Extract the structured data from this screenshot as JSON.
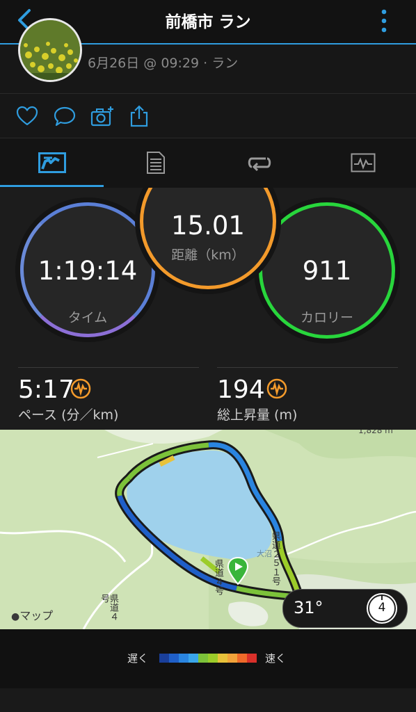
{
  "header": {
    "title": "前橋市 ラン",
    "date_line": "6月26日 @ 09:29 · ラン"
  },
  "icons": {
    "back": "chevron-left-icon",
    "menu": "vertical-ellipsis-icon",
    "like": "heart-icon",
    "comment": "speech-bubble-icon",
    "photo": "camera-add-icon",
    "share": "share-icon"
  },
  "tabs": [
    {
      "name": "overview",
      "icon": "running-chart-icon",
      "active": true
    },
    {
      "name": "details",
      "icon": "document-icon",
      "active": false
    },
    {
      "name": "laps",
      "icon": "laps-loop-icon",
      "active": false
    },
    {
      "name": "charts",
      "icon": "graph-icon",
      "active": false
    }
  ],
  "stats": {
    "time": {
      "value": "1:19:14",
      "label": "タイム"
    },
    "distance": {
      "value": "15.01",
      "label": "距離（km）"
    },
    "calories": {
      "value": "911",
      "label": "カロリー"
    },
    "pace": {
      "value": "5:17",
      "label": "ペース (分／km)"
    },
    "elevation": {
      "value": "194",
      "label": "総上昇量 (m)"
    }
  },
  "map": {
    "attribution": "マップ",
    "scale": "1,828 m",
    "lake_label": "大沼",
    "road_labels": [
      "県道４号",
      "県道２５１号",
      "県道４号"
    ],
    "temperature": "31°",
    "compass_value": "4"
  },
  "legend": {
    "slow": "遅く",
    "fast": "速く",
    "colors": [
      "#1a3f9a",
      "#1f5fc8",
      "#2a85e0",
      "#3aa6ea",
      "#7cc23a",
      "#9ccc2a",
      "#e8c23a",
      "#f2a33a",
      "#ef6a2a",
      "#d9302a"
    ]
  },
  "colors": {
    "accent_blue": "#2f9ddf",
    "time_ring": "#5b7fd6",
    "distance_ring": "#f39a2b",
    "calories_ring": "#28d63c",
    "sensor_orange": "#f39a2b"
  }
}
